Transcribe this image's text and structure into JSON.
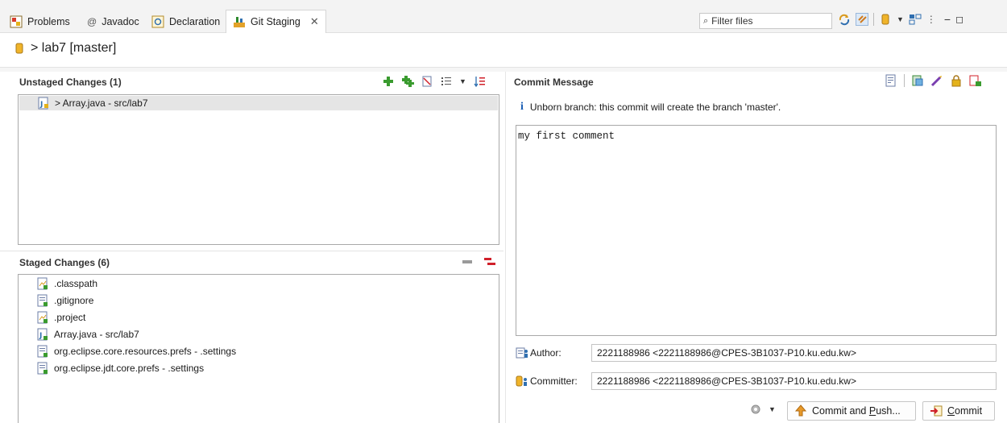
{
  "tabs": [
    {
      "label": "Problems",
      "icon": "problems-icon"
    },
    {
      "label": "Javadoc",
      "icon": "at-icon"
    },
    {
      "label": "Declaration",
      "icon": "declaration-icon"
    },
    {
      "label": "Git Staging",
      "icon": "git-staging-icon",
      "active": true
    }
  ],
  "filter": {
    "placeholder": "Filter files"
  },
  "repo": {
    "path": "> lab7 [master]"
  },
  "unstaged": {
    "title": "Unstaged Changes (1)",
    "items": [
      {
        "label": "> Array.java - src/lab7",
        "icon": "java-file-icon",
        "selected": true
      }
    ]
  },
  "staged": {
    "title": "Staged Changes (6)",
    "items": [
      {
        "label": ".classpath",
        "icon": "added-file-icon"
      },
      {
        "label": ".gitignore",
        "icon": "added-file-icon"
      },
      {
        "label": ".project",
        "icon": "added-file-icon"
      },
      {
        "label": "Array.java - src/lab7",
        "icon": "java-file-icon"
      },
      {
        "label": "org.eclipse.core.resources.prefs - .settings",
        "icon": "added-file-icon"
      },
      {
        "label": "org.eclipse.jdt.core.prefs - .settings",
        "icon": "added-file-icon"
      }
    ]
  },
  "commit": {
    "title": "Commit Message",
    "info": "Unborn branch: this commit will create the branch 'master'.",
    "message": "my first comment",
    "author_label": "Author:",
    "author_value": "2221188986 <2221188986@CPES-3B1037-P10.ku.edu.kw>",
    "committer_label": "Committer:",
    "committer_value": "2221188986 <2221188986@CPES-3B1037-P10.ku.edu.kw>",
    "push_prefix": "Commit and ",
    "push_mnemonic": "P",
    "push_suffix": "ush...",
    "commit_mnemonic": "C",
    "commit_suffix": "ommit"
  },
  "colors": {
    "accent_green": "#3a9b2f",
    "accent_red": "#d0202a",
    "info_blue": "#1b5fb5",
    "selection": "#e5e5e5"
  }
}
